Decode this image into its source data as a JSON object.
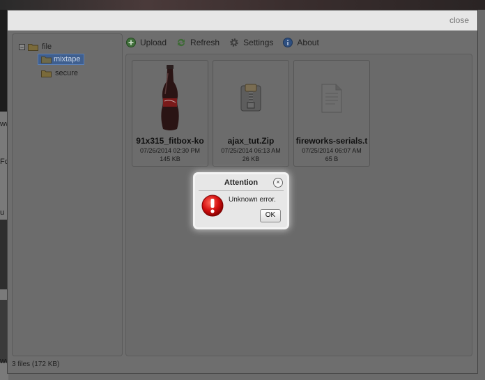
{
  "window": {
    "close_label": "close"
  },
  "tree": {
    "root": {
      "label": "file",
      "toggle": "−"
    },
    "children": [
      {
        "label": "mixtape",
        "selected": true
      },
      {
        "label": "secure",
        "selected": false
      }
    ]
  },
  "toolbar": {
    "upload": "Upload",
    "refresh": "Refresh",
    "settings": "Settings",
    "about": "About"
  },
  "files": [
    {
      "name": "91x315_fitbox-ko",
      "date": "07/26/2014 02:30 PM",
      "size": "145 KB",
      "icon": "coke-bottle-thumbnail"
    },
    {
      "name": "ajax_tut.Zip",
      "date": "07/25/2014 06:13 AM",
      "size": "26 KB",
      "icon": "zip-archive-icon"
    },
    {
      "name": "fireworks-serials.t",
      "date": "07/25/2014 06:07 AM",
      "size": "65 B",
      "icon": "text-document-icon"
    }
  ],
  "status": {
    "summary": "3 files (172 KB)"
  },
  "dialog": {
    "title": "Attention",
    "close_glyph": "×",
    "message": "Unknown error.",
    "ok_label": "OK"
  },
  "background": {
    "left_fragments": [
      "ww",
      "Fo",
      "u",
      "ww"
    ]
  }
}
